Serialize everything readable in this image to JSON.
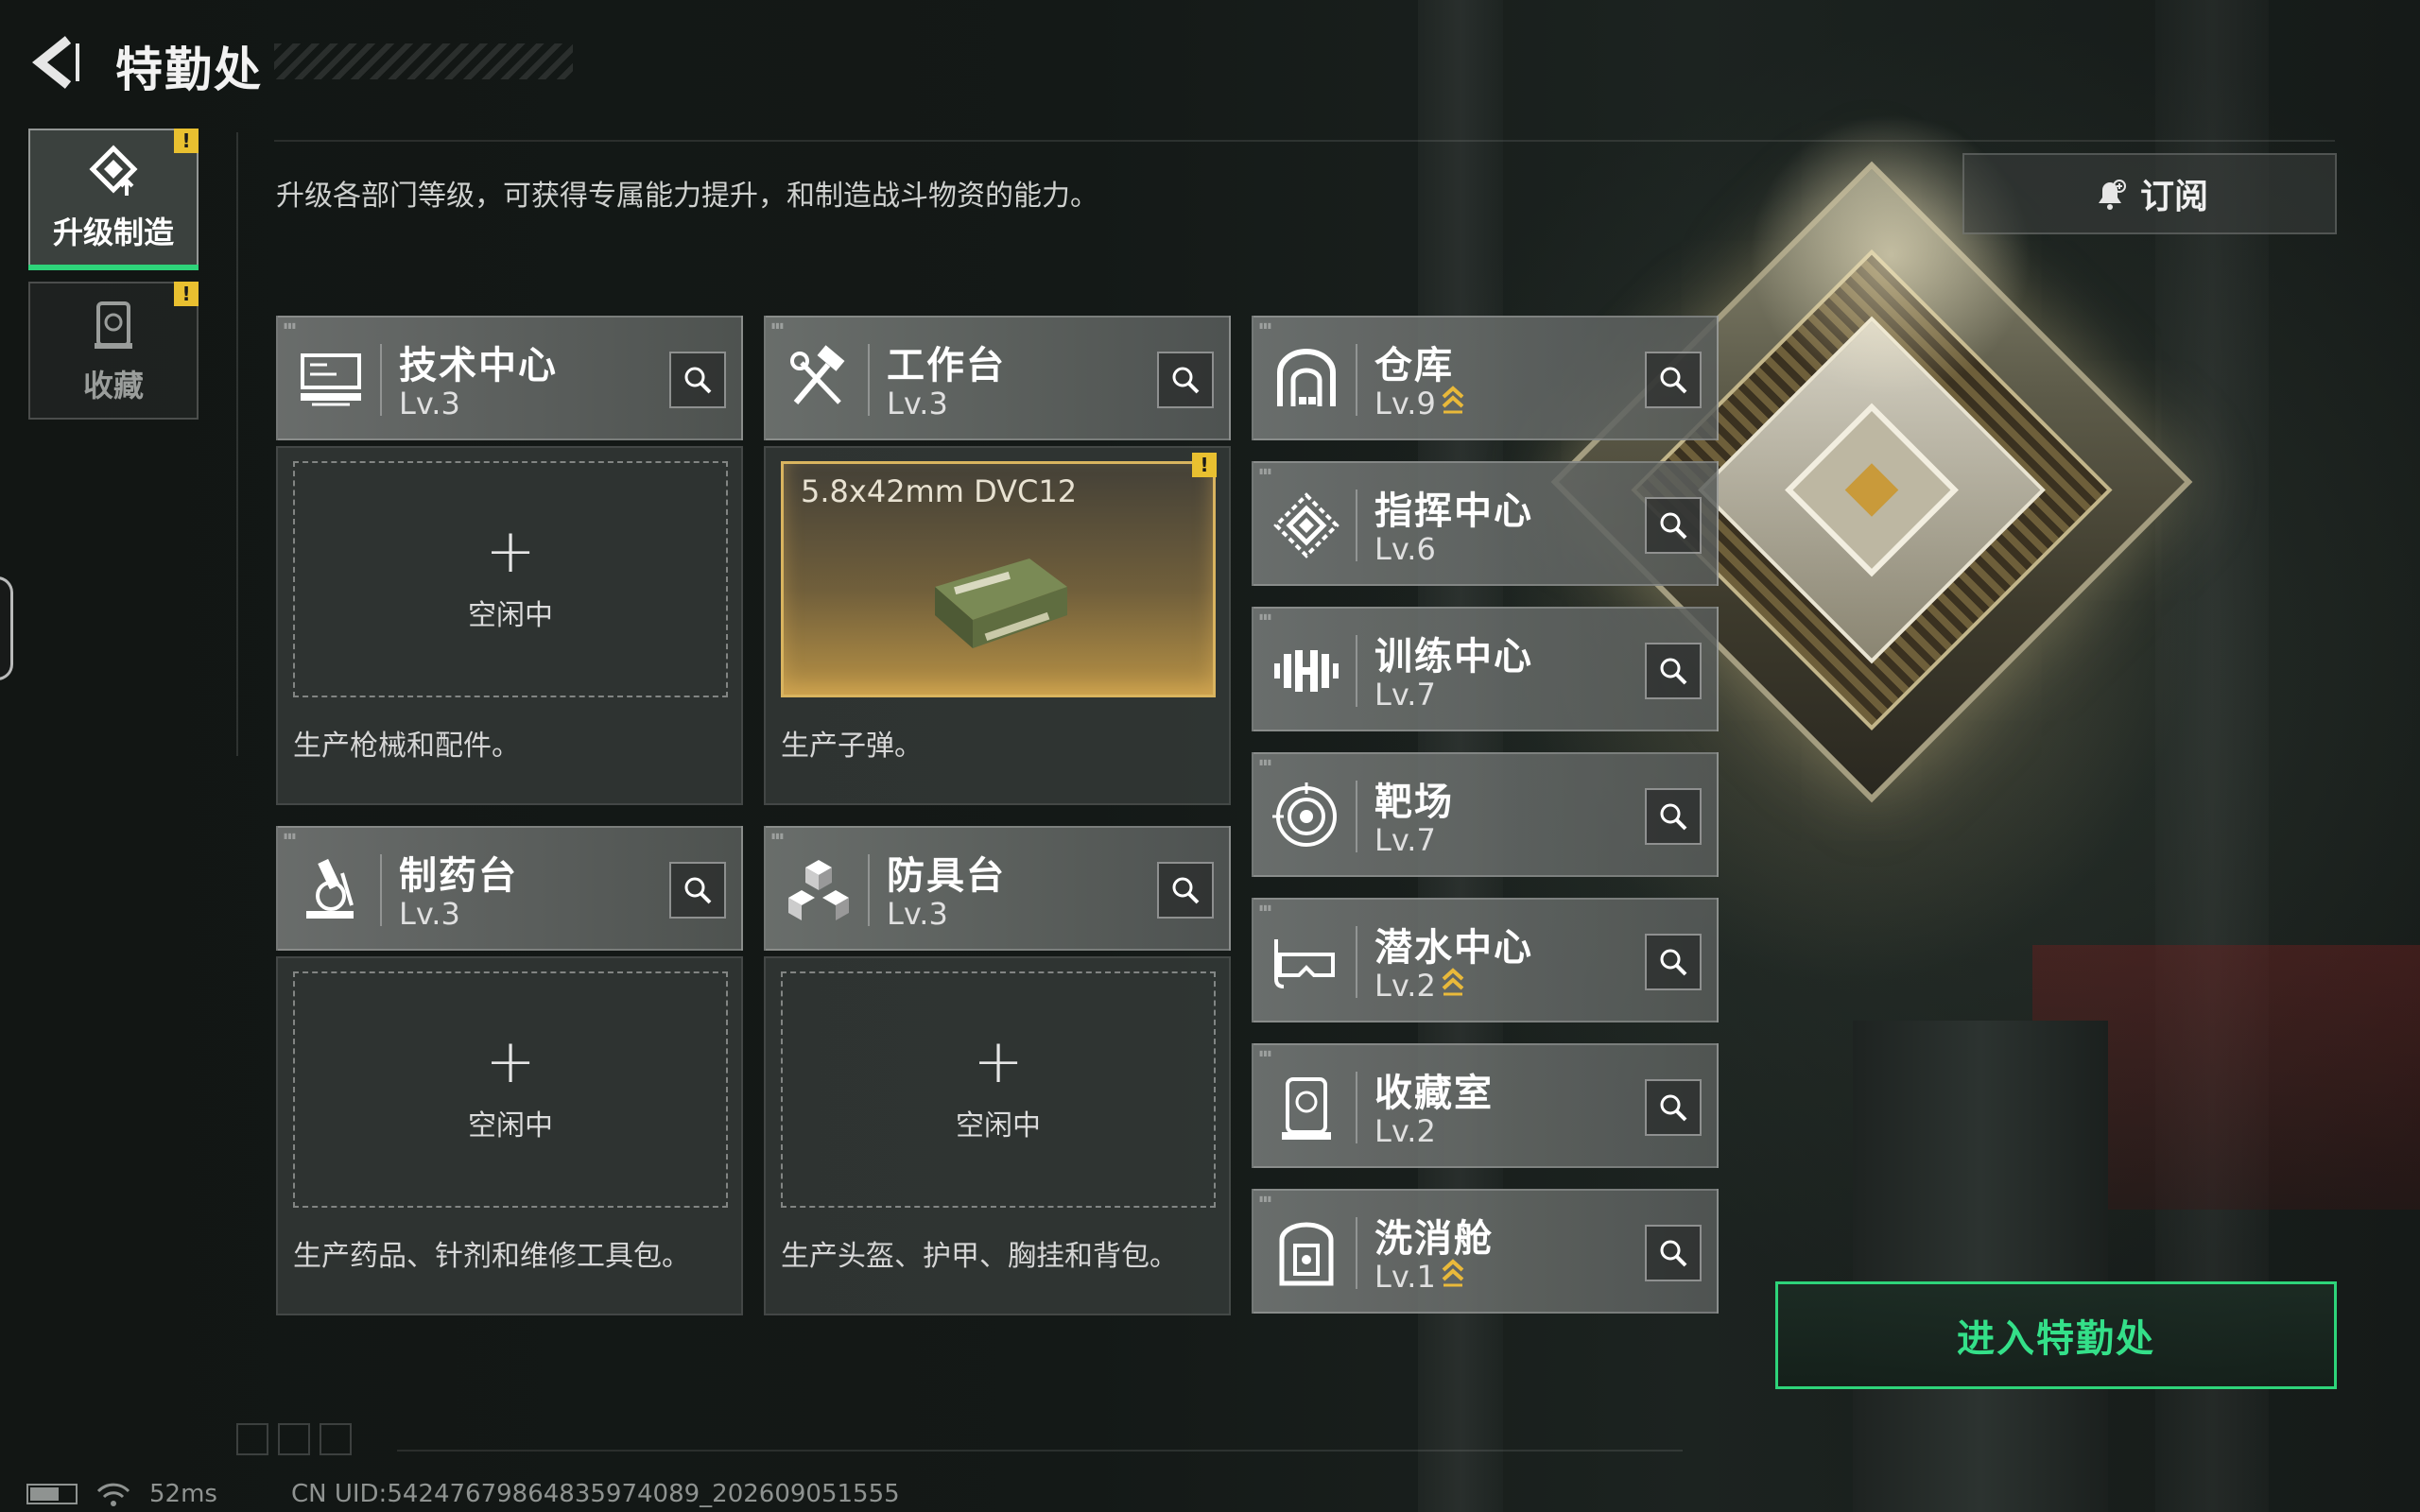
{
  "header": {
    "title": "特勤处",
    "description": "升级各部门等级，可获得专属能力提升，和制造战斗物资的能力。",
    "subscribe_label": "订阅"
  },
  "tabs": [
    {
      "label": "升级制造",
      "active": true,
      "alert": "!"
    },
    {
      "label": "收藏",
      "active": false,
      "alert": "!"
    }
  ],
  "workshops": [
    {
      "name": "技术中心",
      "level": "Lv.3",
      "status": "空闲中",
      "description": "生产枪械和配件。"
    },
    {
      "name": "工作台",
      "level": "Lv.3",
      "producing": "5.8x42mm DVC12",
      "alert": "!",
      "description": "生产子弹。"
    },
    {
      "name": "制药台",
      "level": "Lv.3",
      "status": "空闲中",
      "description": "生产药品、针剂和维修工具包。"
    },
    {
      "name": "防具台",
      "level": "Lv.3",
      "status": "空闲中",
      "description": "生产头盔、护甲、胸挂和背包。"
    }
  ],
  "facilities": [
    {
      "name": "仓库",
      "level": "Lv.9",
      "upgradable": true
    },
    {
      "name": "指挥中心",
      "level": "Lv.6",
      "upgradable": false
    },
    {
      "name": "训练中心",
      "level": "Lv.7",
      "upgradable": false
    },
    {
      "name": "靶场",
      "level": "Lv.7",
      "upgradable": false
    },
    {
      "name": "潜水中心",
      "level": "Lv.2",
      "upgradable": true
    },
    {
      "name": "收藏室",
      "level": "Lv.2",
      "upgradable": false
    },
    {
      "name": "洗消舱",
      "level": "Lv.1",
      "upgradable": true
    }
  ],
  "enter_button": "进入特勤处",
  "status_bar": {
    "ping": "52ms",
    "uid": "CN UID:54247679864835974089_202609051555"
  },
  "colors": {
    "accent": "#2ed47a",
    "alert": "#e9c030",
    "upgrade": "#e9b93a"
  }
}
